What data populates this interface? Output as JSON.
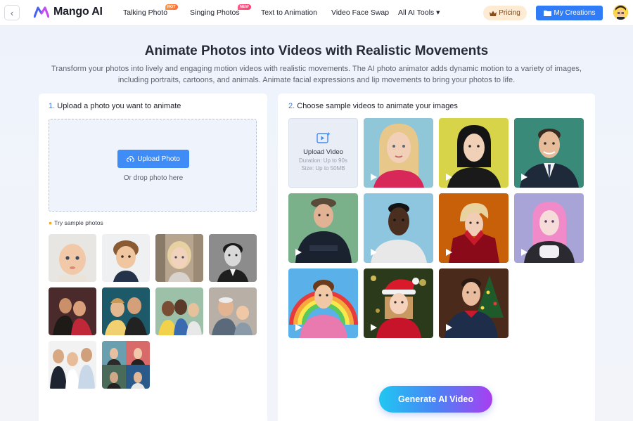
{
  "header": {
    "back_label": "‹",
    "logo_text": "Mango AI",
    "nav": [
      {
        "label": "Talking Photo",
        "badge": "HOT"
      },
      {
        "label": "Singing Photos",
        "badge": "NEW"
      },
      {
        "label": "Text to Animation"
      },
      {
        "label": "Video Face Swap"
      },
      {
        "label": "All AI Tools ▾"
      }
    ],
    "pricing_label": "Pricing",
    "my_creations_label": "My Creations"
  },
  "hero": {
    "title": "Animate Photos into Videos with Realistic Movements",
    "description": "Transform your photos into lively and engaging motion videos with realistic movements. The AI photo animator adds dynamic motion to a variety of images, including portraits, cartoons, and animals. Animate facial expressions and lip movements to bring your photos to life."
  },
  "left_panel": {
    "step_number": "1.",
    "step_title": "Upload a photo you want to animate",
    "upload_button": "Upload Photo",
    "drop_hint": "Or drop photo here",
    "try_label": "Try sample photos"
  },
  "right_panel": {
    "step_number": "2.",
    "step_title": "Choose sample videos to animate your images",
    "upload_video": {
      "title": "Upload Video",
      "duration": "Duration: Up to 90s",
      "size": "Size: Up to 50MB"
    },
    "generate_button": "Generate AI Video"
  },
  "colors": {
    "accent": "#2f7cf6",
    "pricing_bg": "#fdebd3"
  }
}
